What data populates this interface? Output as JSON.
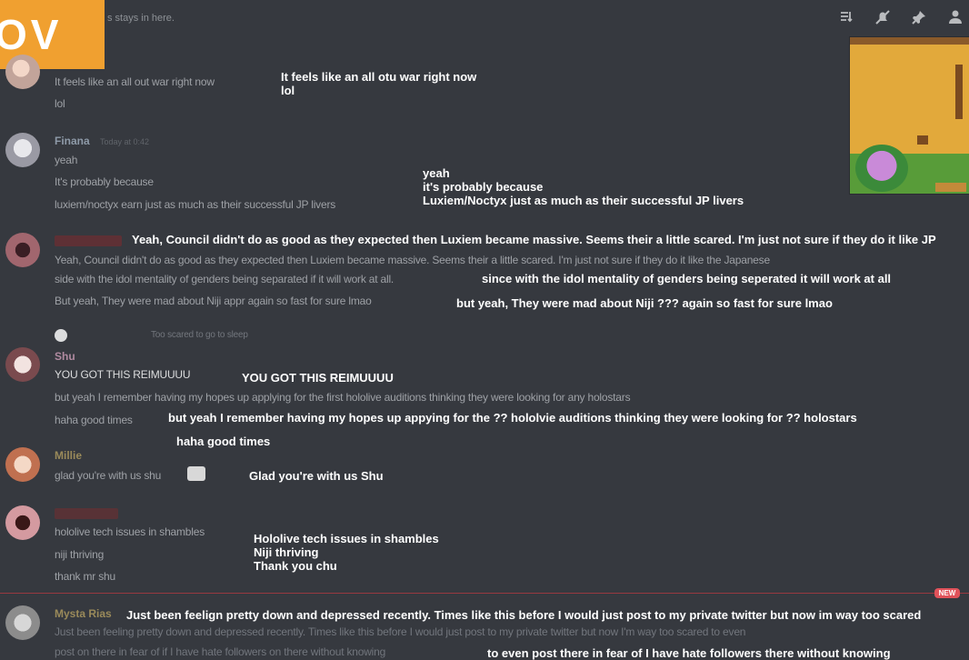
{
  "logo": {
    "text": "OV"
  },
  "top_message": "s stays in here.",
  "toolbar": {
    "icons": [
      "threads-icon",
      "bell-muted-icon",
      "pin-icon",
      "members-icon"
    ]
  },
  "messages": [
    {
      "username": "",
      "timestamp": "",
      "lines": [
        "It feels like an all out war right now",
        "lol"
      ],
      "subtitle": [
        "It feels like an all otu war right now",
        "lol"
      ]
    },
    {
      "username": "Finana",
      "timestamp": "Today at 0:42",
      "lines": [
        "yeah",
        "It's probably because",
        "luxiem/noctyx earn just as much as their successful JP livers"
      ],
      "subtitle": [
        "yeah",
        "it's probably because",
        "Luxiem/Noctyx just as much as their successful JP livers"
      ]
    },
    {
      "username": "",
      "timestamp": "",
      "lines": [
        "Yeah, Council didn't do as good as they expected then Luxiem became massive. Seems their a little scared. I'm just not sure if they do it like the Japanese",
        "side with the idol mentality of genders being separated if it will work at all.",
        "But yeah, They were mad about Niji appr again so fast for sure lmao"
      ],
      "subtitle": [
        "Yeah, Council didn't do as good as they expected then Luxiem became massive. Seems their a little scared. I'm just not sure if they do it like JP",
        "since with the idol mentality of genders being seperated it will work at all",
        "but yeah, They were mad about Niji ??? again so fast for sure lmao"
      ]
    },
    {
      "username": "Shu",
      "timestamp": "",
      "reply": "Too scared to go to sleep",
      "lines": [
        "YOU GOT THIS REIMUUUU",
        "but yeah I remember having my hopes up applying for the first hololive auditions thinking they were looking for any holostars",
        "haha good times"
      ],
      "subtitle": [
        "YOU GOT THIS REIMUUUU",
        "but yeah I remember having my hopes up appying for the ?? hololvie auditions thinking they were looking for ?? holostars",
        "haha good times"
      ]
    },
    {
      "username": "Millie",
      "timestamp": "",
      "lines": [
        "glad you're with us shu"
      ],
      "subtitle": [
        "Glad you're with us Shu"
      ]
    },
    {
      "username": "",
      "timestamp": "",
      "lines": [
        "hololive tech issues in shambles",
        "niji thriving",
        "thank mr shu"
      ],
      "subtitle": [
        "Hololive tech issues in shambles",
        "Niji thriving",
        "Thank you chu"
      ]
    },
    {
      "username": "Mysta Rias",
      "timestamp": "",
      "lines": [
        "Just been feeling pretty down and depressed recently. Times like this before I would just post to my private twitter but now I'm way too scared to even",
        "post on there in fear of if I have hate followers on there without knowing"
      ],
      "subtitle": [
        "Just been feelign pretty down and depressed recently. Times like this before I would just post to my private twitter but now im way too scared",
        "to even post there in fear of I have hate followers there without knowing"
      ]
    }
  ],
  "new_badge": "NEW",
  "colors": {
    "background": "#36393f",
    "logo": "#f0a030",
    "divider": "#a33a40",
    "subtitle": "#ffffff"
  }
}
